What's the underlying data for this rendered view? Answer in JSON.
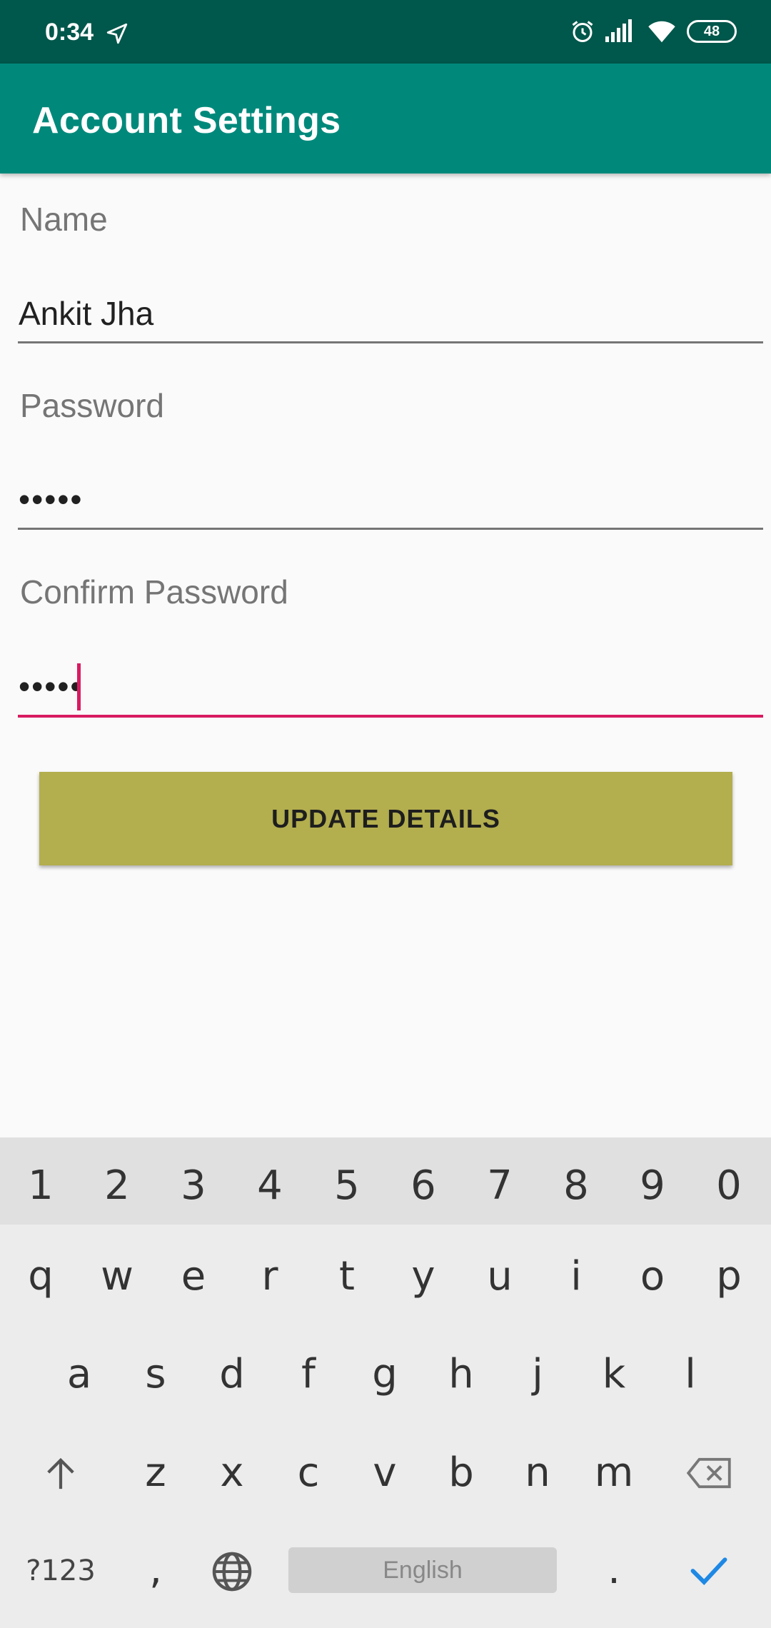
{
  "status_bar": {
    "time": "0:34",
    "battery": "48",
    "icons": [
      "navigation-arrow-icon",
      "alarm-icon",
      "signal-icon",
      "wifi-icon",
      "battery-icon"
    ]
  },
  "app_bar": {
    "title": "Account Settings"
  },
  "form": {
    "name": {
      "label": "Name",
      "value": "Ankit Jha"
    },
    "password": {
      "label": "Password",
      "value": "•••••"
    },
    "confirm_password": {
      "label": "Confirm Password",
      "value": "•••••"
    },
    "submit_label": "UPDATE DETAILS"
  },
  "keyboard": {
    "number_row": [
      "1",
      "2",
      "3",
      "4",
      "5",
      "6",
      "7",
      "8",
      "9",
      "0"
    ],
    "row1": [
      "q",
      "w",
      "e",
      "r",
      "t",
      "y",
      "u",
      "i",
      "o",
      "p"
    ],
    "row2": [
      "a",
      "s",
      "d",
      "f",
      "g",
      "h",
      "j",
      "k",
      "l"
    ],
    "row3": [
      "z",
      "x",
      "c",
      "v",
      "b",
      "n",
      "m"
    ],
    "symbols_key": "?123",
    "comma_key": ",",
    "period_key": ".",
    "space_label": "English"
  },
  "colors": {
    "status_bar": "#00574b",
    "app_bar": "#00897b",
    "accent": "#d81b60",
    "button": "#b3ae4e",
    "check": "#1e88e5"
  }
}
